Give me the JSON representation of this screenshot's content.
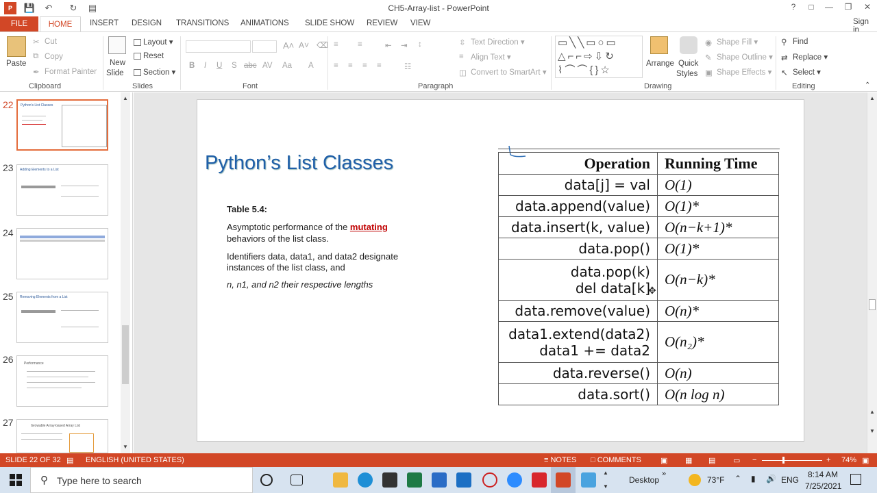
{
  "window": {
    "title": "CH5-Array-list - PowerPoint"
  },
  "tabs": {
    "file": "FILE",
    "home": "HOME",
    "insert": "INSERT",
    "design": "DESIGN",
    "transitions": "TRANSITIONS",
    "animations": "ANIMATIONS",
    "slideshow": "SLIDE SHOW",
    "review": "REVIEW",
    "view": "VIEW",
    "signin": "Sign in"
  },
  "ribbon": {
    "clipboard": {
      "paste": "Paste",
      "cut": "Cut",
      "copy": "Copy",
      "format_painter": "Format Painter",
      "label": "Clipboard"
    },
    "slides": {
      "new_slide_1": "New",
      "new_slide_2": "Slide",
      "layout": "Layout",
      "reset": "Reset",
      "section": "Section",
      "label": "Slides"
    },
    "font": {
      "label": "Font"
    },
    "paragraph": {
      "text_direction": "Text Direction",
      "align_text": "Align Text",
      "convert_smartart": "Convert to SmartArt",
      "label": "Paragraph"
    },
    "drawing": {
      "arrange": "Arrange",
      "quick_styles_1": "Quick",
      "quick_styles_2": "Styles",
      "shape_fill": "Shape Fill",
      "shape_outline": "Shape Outline",
      "shape_effects": "Shape Effects",
      "label": "Drawing"
    },
    "editing": {
      "find": "Find",
      "replace": "Replace",
      "select": "Select",
      "label": "Editing"
    }
  },
  "thumbnails": [
    {
      "num": "22",
      "title": "Python's List Classes"
    },
    {
      "num": "23",
      "title": "Adding Elements to a List"
    },
    {
      "num": "24",
      "title": ""
    },
    {
      "num": "25",
      "title": "Removing Elements from a List"
    },
    {
      "num": "26",
      "title": "Performance"
    },
    {
      "num": "27",
      "title": "Growable Array-based Array List"
    }
  ],
  "slide": {
    "title": "Python’s List Classes",
    "table_label": "Table 5.4:",
    "para1_pre": "Asymptotic performance of the ",
    "para1_link": "mutating",
    "para1_post": "behaviors of the list class.",
    "para2_line1": "Identifiers data, data1, and data2 designate",
    "para2_line2": "instances of the list class, and",
    "para3": "n, n1, and n2  their respective lengths",
    "table": {
      "headers": [
        "Operation",
        "Running Time"
      ],
      "rows": [
        {
          "op": "data[j] = val",
          "op2": "",
          "rt": "O(1)"
        },
        {
          "op": "data.append(value)",
          "op2": "",
          "rt": "O(1)*"
        },
        {
          "op": "data.insert(k, value)",
          "op2": "",
          "rt": "O(n−k+1)*"
        },
        {
          "op": "data.pop()",
          "op2": "",
          "rt": "O(1)*"
        },
        {
          "op": "data.pop(k)",
          "op2": "del data[k]",
          "rt": "O(n−k)*"
        },
        {
          "op": "data.remove(value)",
          "op2": "",
          "rt": "O(n)*"
        },
        {
          "op": "data1.extend(data2)",
          "op2": "data1 += data2",
          "rt": "O(n₂)*"
        },
        {
          "op": "data.reverse()",
          "op2": "",
          "rt": "O(n)"
        },
        {
          "op": "data.sort()",
          "op2": "",
          "rt": "O(n log n)"
        }
      ]
    }
  },
  "status": {
    "slide": "SLIDE 22 OF 32",
    "language": "ENGLISH (UNITED STATES)",
    "notes": "NOTES",
    "comments": "COMMENTS",
    "zoom": "74%"
  },
  "taskbar": {
    "search_placeholder": "Type here to search",
    "desktop": "Desktop",
    "weather": "73°F",
    "lang": "ENG",
    "time": "8:14 AM",
    "date": "7/25/2021"
  },
  "colors": {
    "accent": "#d24726",
    "title_blue": "#1f5fa8",
    "link_red": "#c00000"
  }
}
